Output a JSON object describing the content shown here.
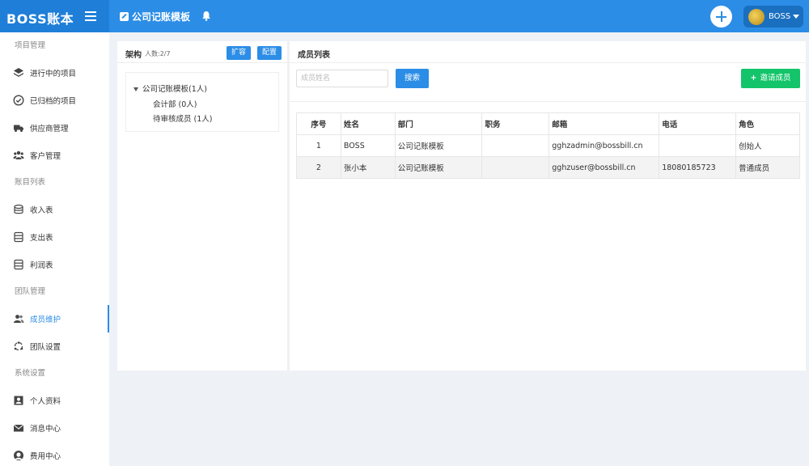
{
  "brand": {
    "name": "BOSS账本"
  },
  "topbar": {
    "doc_title": "公司记账模板",
    "user_name": "BOSS"
  },
  "sidebar": {
    "groups": [
      {
        "label": "项目管理"
      },
      {
        "label": "账目列表"
      },
      {
        "label": "团队管理"
      },
      {
        "label": "系统设置"
      }
    ],
    "items": [
      {
        "label": "进行中的项目",
        "icon": "layers-icon"
      },
      {
        "label": "已归档的项目",
        "icon": "check-circle-icon"
      },
      {
        "label": "供应商管理",
        "icon": "truck-icon"
      },
      {
        "label": "客户管理",
        "icon": "users-icon"
      },
      {
        "label": "收入表",
        "icon": "database-icon"
      },
      {
        "label": "支出表",
        "icon": "database-icon"
      },
      {
        "label": "利润表",
        "icon": "database-icon"
      },
      {
        "label": "成员维护",
        "icon": "user-group-icon",
        "active": true
      },
      {
        "label": "团队设置",
        "icon": "team-settings-icon"
      },
      {
        "label": "个人资料",
        "icon": "profile-icon"
      },
      {
        "label": "消息中心",
        "icon": "envelope-icon"
      },
      {
        "label": "费用中心",
        "icon": "fee-icon"
      }
    ]
  },
  "structure": {
    "title": "架构",
    "count": "人数:2/7",
    "expand_label": "扩容",
    "config_label": "配置",
    "tree": {
      "root": "公司记账模板(1人)",
      "children": [
        "会计部 (0人)",
        "待审核成员 (1人)"
      ]
    }
  },
  "members": {
    "title": "成员列表",
    "search_placeholder": "成员姓名",
    "search_label": "搜索",
    "invite_label": "邀请成员",
    "columns": [
      "序号",
      "姓名",
      "部门",
      "职务",
      "邮箱",
      "电话",
      "角色"
    ],
    "rows": [
      {
        "index": "1",
        "name": "BOSS",
        "dept": "公司记账模板",
        "title": "",
        "email": "gghzadmin@bossbill.cn",
        "phone": "",
        "role": "创始人"
      },
      {
        "index": "2",
        "name": "张小本",
        "dept": "公司记账模板",
        "title": "",
        "email": "gghzuser@bossbill.cn",
        "phone": "18080185723",
        "role": "普通成员"
      }
    ]
  },
  "colors": {
    "primary": "#2b8de6",
    "brand_bg": "#1f7fd8",
    "success": "#13c46a"
  }
}
